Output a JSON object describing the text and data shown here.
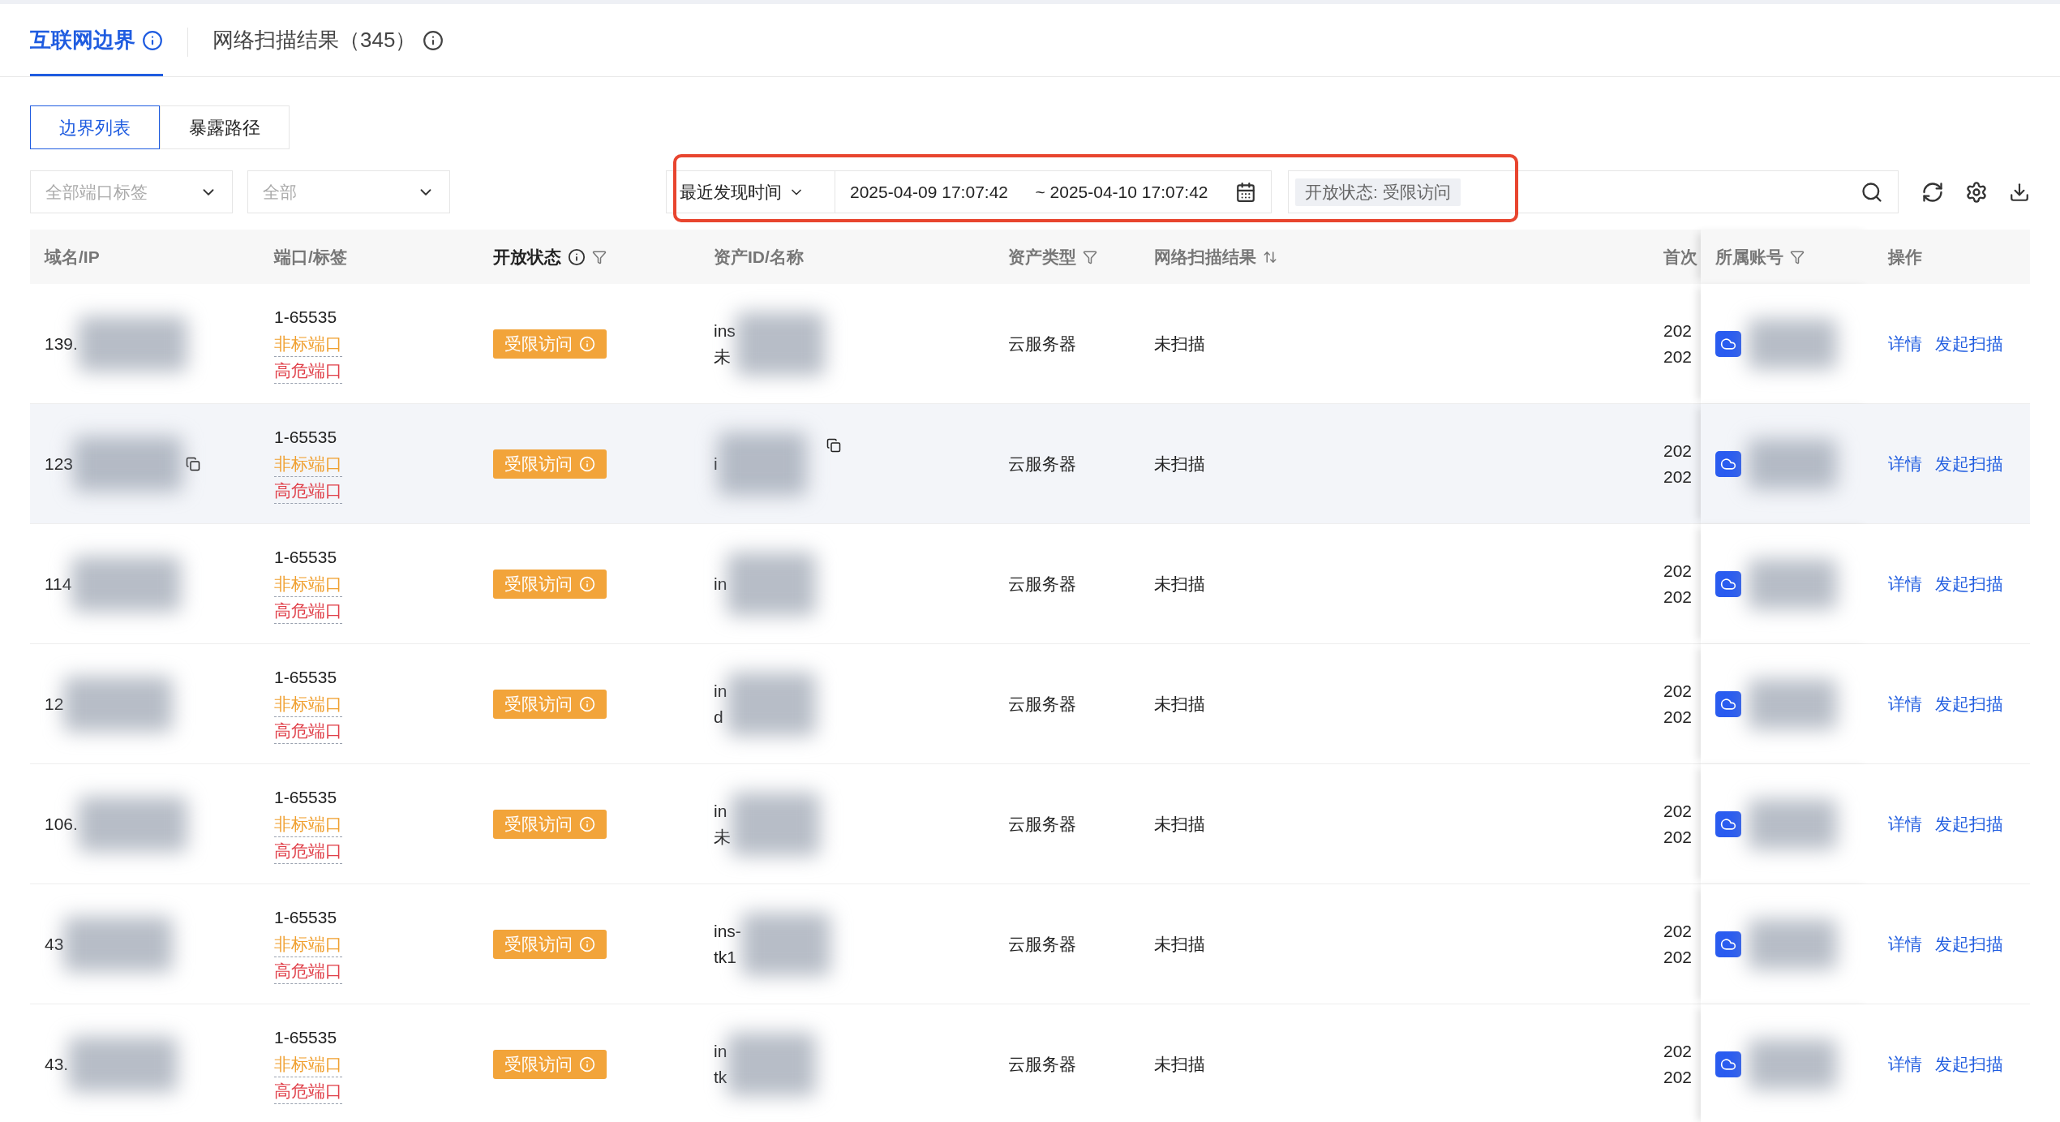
{
  "tabs": [
    {
      "label": "互联网边界",
      "selected": true,
      "info": true
    },
    {
      "label": "网络扫描结果（345）",
      "selected": false,
      "info": true
    }
  ],
  "view_switch": [
    {
      "label": "边界列表",
      "selected": true
    },
    {
      "label": "暴露路径",
      "selected": false
    }
  ],
  "filters": [
    {
      "placeholder": "全部端口标签"
    },
    {
      "placeholder": "全部"
    }
  ],
  "time_filter": {
    "field": "最近发现时间",
    "start": "2025-04-09 17:07:42",
    "end": "~ 2025-04-10 17:07:42"
  },
  "search": {
    "tag": "开放状态: 受限访问"
  },
  "table": {
    "columns": [
      {
        "label": "域名/IP",
        "active": false,
        "info": false,
        "filter": false,
        "sort": false
      },
      {
        "label": "端口/标签",
        "active": false,
        "info": false,
        "filter": false,
        "sort": false
      },
      {
        "label": "开放状态",
        "active": true,
        "info": true,
        "filter": true,
        "sort": false
      },
      {
        "label": "资产ID/名称",
        "active": false,
        "info": false,
        "filter": false,
        "sort": false
      },
      {
        "label": "资产类型",
        "active": false,
        "info": false,
        "filter": true,
        "sort": false
      },
      {
        "label": "网络扫描结果",
        "active": false,
        "info": false,
        "filter": false,
        "sort": true
      },
      {
        "label": "首次",
        "active": false,
        "info": false,
        "filter": false,
        "sort": false
      },
      {
        "label": "所属账号",
        "active": false,
        "info": false,
        "filter": true,
        "sort": false
      },
      {
        "label": "操作",
        "active": false,
        "info": false,
        "filter": false,
        "sort": false
      }
    ],
    "rows": [
      {
        "domain": "139.",
        "domain_copy": false,
        "hovered": false,
        "port_range": "1-65535",
        "tags": [
          {
            "label": "非标端口",
            "kind": "warning"
          },
          {
            "label": "高危端口",
            "kind": "danger"
          }
        ],
        "status": "受限访问",
        "asset_lines": [
          "ins",
          "未"
        ],
        "asset_copy": false,
        "asset_type": "云服务器",
        "scan_result": "未扫描",
        "first_seen": [
          "202",
          "202"
        ],
        "actions": [
          "详情",
          "发起扫描"
        ]
      },
      {
        "domain": "123",
        "domain_copy": true,
        "hovered": true,
        "port_range": "1-65535",
        "tags": [
          {
            "label": "非标端口",
            "kind": "warning"
          },
          {
            "label": "高危端口",
            "kind": "danger"
          }
        ],
        "status": "受限访问",
        "asset_lines": [
          "i"
        ],
        "asset_copy": true,
        "asset_type": "云服务器",
        "scan_result": "未扫描",
        "first_seen": [
          "202",
          "202"
        ],
        "actions": [
          "详情",
          "发起扫描"
        ]
      },
      {
        "domain": "114",
        "domain_copy": false,
        "hovered": false,
        "port_range": "1-65535",
        "tags": [
          {
            "label": "非标端口",
            "kind": "warning"
          },
          {
            "label": "高危端口",
            "kind": "danger"
          }
        ],
        "status": "受限访问",
        "asset_lines": [
          "in"
        ],
        "asset_copy": false,
        "asset_type": "云服务器",
        "scan_result": "未扫描",
        "first_seen": [
          "202",
          "202"
        ],
        "actions": [
          "详情",
          "发起扫描"
        ]
      },
      {
        "domain": "12",
        "domain_copy": false,
        "hovered": false,
        "port_range": "1-65535",
        "tags": [
          {
            "label": "非标端口",
            "kind": "warning"
          },
          {
            "label": "高危端口",
            "kind": "danger"
          }
        ],
        "status": "受限访问",
        "asset_lines": [
          "in",
          "d"
        ],
        "asset_copy": false,
        "asset_type": "云服务器",
        "scan_result": "未扫描",
        "first_seen": [
          "202",
          "202"
        ],
        "actions": [
          "详情",
          "发起扫描"
        ]
      },
      {
        "domain": "106.",
        "domain_copy": false,
        "hovered": false,
        "port_range": "1-65535",
        "tags": [
          {
            "label": "非标端口",
            "kind": "warning"
          },
          {
            "label": "高危端口",
            "kind": "danger"
          }
        ],
        "status": "受限访问",
        "asset_lines": [
          "in",
          "未"
        ],
        "asset_copy": false,
        "asset_type": "云服务器",
        "scan_result": "未扫描",
        "first_seen": [
          "202",
          "202"
        ],
        "actions": [
          "详情",
          "发起扫描"
        ]
      },
      {
        "domain": "43",
        "domain_copy": false,
        "hovered": false,
        "port_range": "1-65535",
        "tags": [
          {
            "label": "非标端口",
            "kind": "warning"
          },
          {
            "label": "高危端口",
            "kind": "danger"
          }
        ],
        "status": "受限访问",
        "asset_lines": [
          "ins-",
          "tk1"
        ],
        "asset_copy": false,
        "asset_type": "云服务器",
        "scan_result": "未扫描",
        "first_seen": [
          "202",
          "202"
        ],
        "actions": [
          "详情",
          "发起扫描"
        ]
      },
      {
        "domain": "43.",
        "domain_copy": false,
        "hovered": false,
        "port_range": "1-65535",
        "tags": [
          {
            "label": "非标端口",
            "kind": "warning"
          },
          {
            "label": "高危端口",
            "kind": "danger"
          }
        ],
        "status": "受限访问",
        "asset_lines": [
          "in",
          "tk"
        ],
        "asset_copy": false,
        "asset_type": "云服务器",
        "scan_result": "未扫描",
        "first_seen": [
          "202",
          "202"
        ],
        "actions": [
          "详情",
          "发起扫描"
        ]
      }
    ]
  }
}
